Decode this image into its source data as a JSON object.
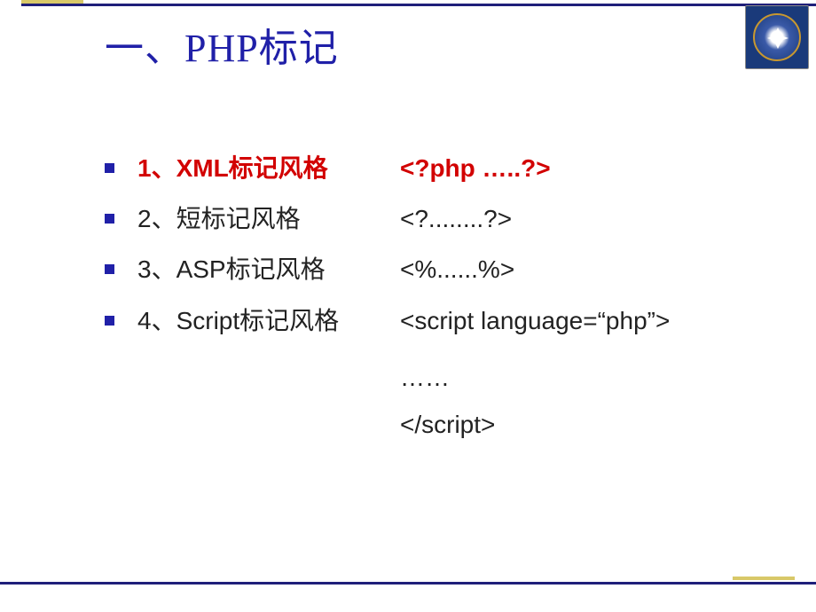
{
  "slide": {
    "title": "一、PHP标记"
  },
  "items": [
    {
      "num": "1",
      "label": "1、XML标记风格",
      "sample": "<?php …..?>",
      "highlighted": true
    },
    {
      "num": "2",
      "label": "2、短标记风格",
      "sample": "<?........?>",
      "highlighted": false
    },
    {
      "num": "3",
      "label": "3、ASP标记风格",
      "sample": "<%......%>",
      "highlighted": false
    },
    {
      "num": "4",
      "label": "4、Script标记风格",
      "sample": "<script language=“php”>",
      "highlighted": false
    }
  ],
  "scriptExtra": {
    "line1": " ……",
    "line2": "</script>"
  }
}
